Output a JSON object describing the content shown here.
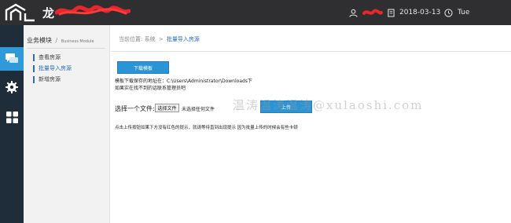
{
  "header": {
    "brand_text": "龙",
    "user_name": "",
    "date": "2018-03-13",
    "day": "Tue",
    "icons": [
      "logo-icon",
      "user-icon",
      "calendar-icon",
      "clock-icon"
    ]
  },
  "rail": {
    "items": [
      {
        "name": "chat-icon",
        "active": true
      },
      {
        "name": "gear-icon",
        "active": false
      },
      {
        "name": "grid-icon",
        "active": false
      }
    ],
    "colors": {
      "bg": "#1f2d3b",
      "active": "#2e9ad9"
    }
  },
  "sidebar": {
    "title": "业务模块",
    "slash": "/",
    "subtitle": "Business Module",
    "items": [
      {
        "label": "查看房源",
        "active": false
      },
      {
        "label": "批量导入房源",
        "active": true
      },
      {
        "label": "新增房源",
        "active": false
      }
    ]
  },
  "main": {
    "breadcrumb": {
      "prefix": "当前位置:",
      "level1": "系统",
      "sep": ">",
      "current": "批量导入房源"
    },
    "download_button": "下载模板",
    "note_line1": "模板下载保存的地址在：C:\\Users\\Administrator\\Downloads下",
    "note_line2": "如果实在找不到的话联系管理员吧",
    "file_label": "选择一个文件:",
    "file_button": "选择文件",
    "file_status": "未选择任何文件",
    "upload_button": "上传",
    "watermark": "温涛温涛温涛@xulaoshi.com",
    "note_line3": "点击上传按钮如果下方没有红色的提示，就请等待直到出现提示 因为批量上传的时候会有些卡顿"
  },
  "colors": {
    "topbar": "#2f2f31",
    "accent": "#2b94d6",
    "link": "#2e6db4"
  }
}
